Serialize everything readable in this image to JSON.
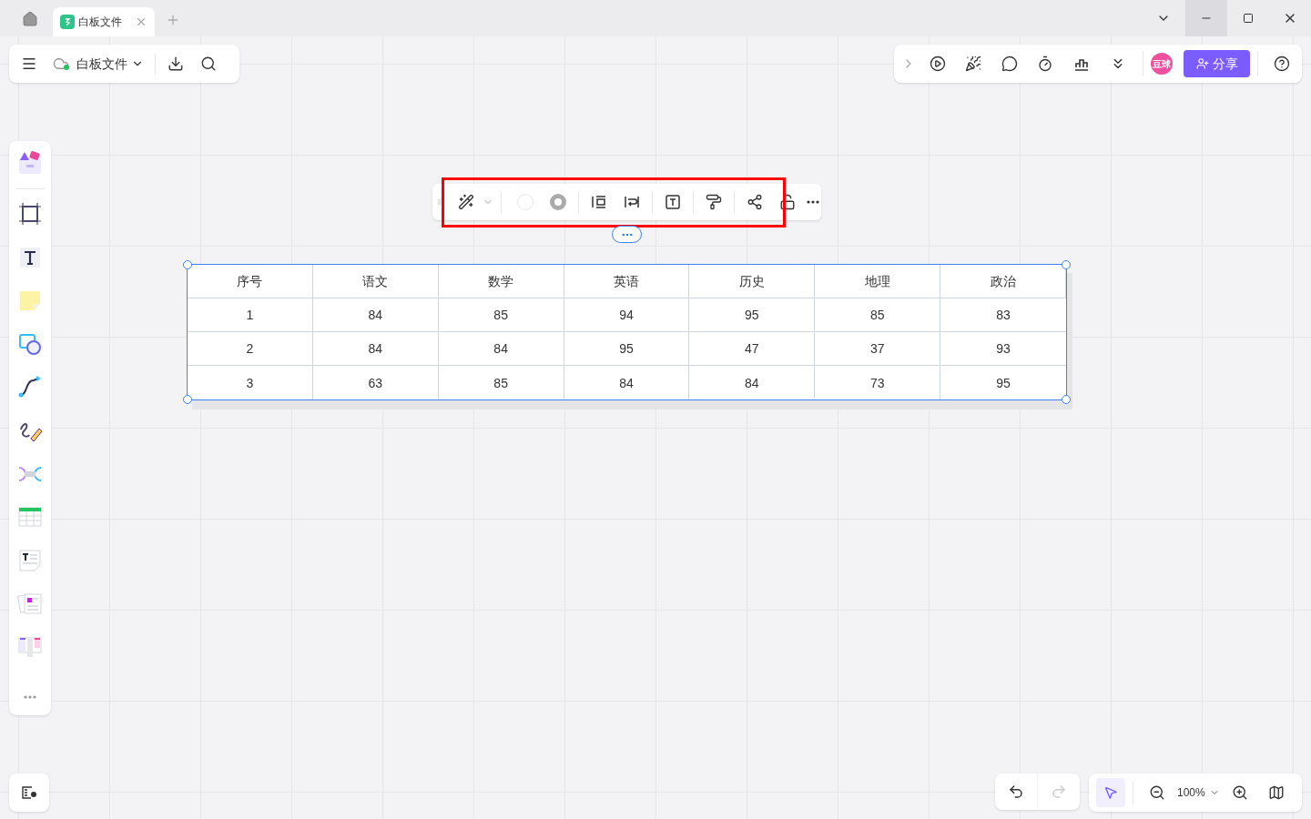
{
  "tabs": [
    {
      "label": "白板文件",
      "selected": true
    }
  ],
  "file_toolbar": {
    "file_name": "白板文件",
    "synced": true
  },
  "share_toolbar": {
    "avatar": "豆球",
    "share_button": "分享"
  },
  "table_toolbar": {
    "highlighted": true
  },
  "table": {
    "columns": [
      "序号",
      "语文",
      "数学",
      "英语",
      "历史",
      "地理",
      "政治"
    ],
    "rows": [
      [
        "1",
        "84",
        "85",
        "94",
        "95",
        "85",
        "83"
      ],
      [
        "2",
        "84",
        "84",
        "95",
        "47",
        "37",
        "93"
      ],
      [
        "3",
        "63",
        "85",
        "84",
        "84",
        "73",
        "95"
      ]
    ],
    "selected": true
  },
  "history": {
    "undo_disabled": false,
    "redo_disabled": true
  },
  "zoom_bar": {
    "select_tool_selected": true,
    "zoom": "100%"
  }
}
